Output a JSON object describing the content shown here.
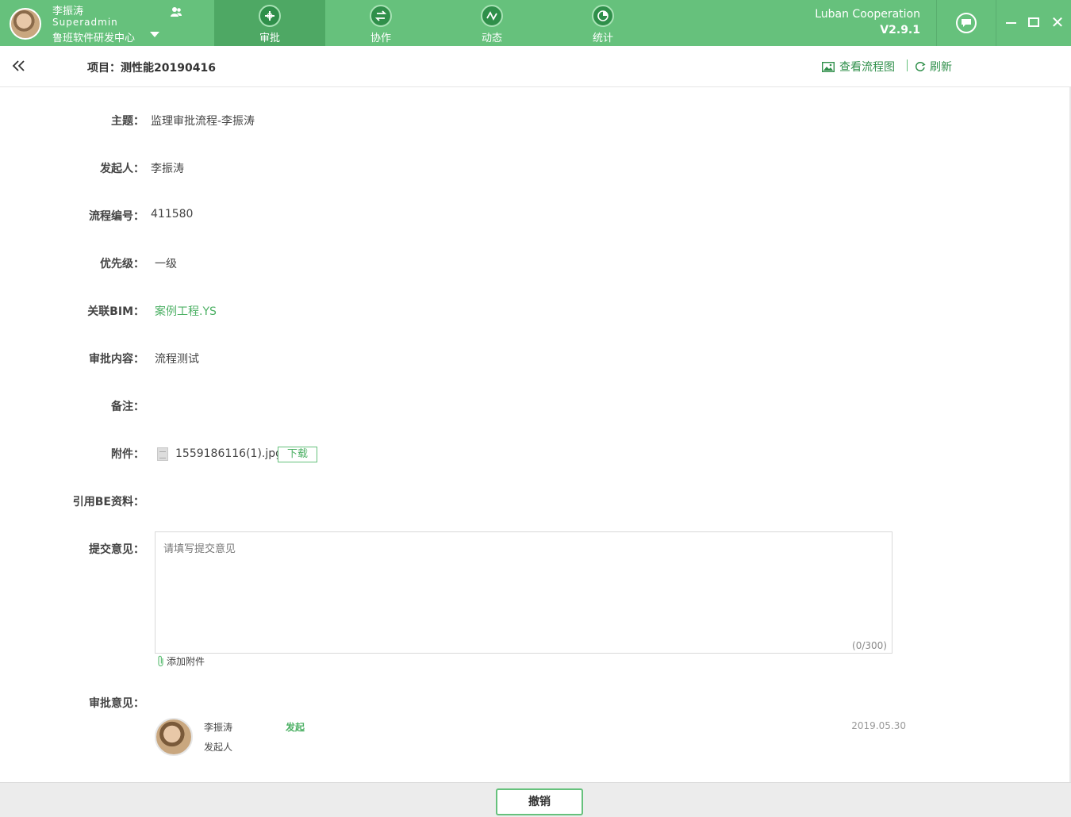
{
  "user": {
    "name": "李振涛",
    "role": "Superadmin",
    "org": "鲁班软件研发中心"
  },
  "nav": {
    "tabs": [
      {
        "label": "审批",
        "icon": "approval-icon",
        "active": true
      },
      {
        "label": "协作",
        "icon": "collaborate-icon",
        "active": false
      },
      {
        "label": "动态",
        "icon": "activity-icon",
        "active": false
      },
      {
        "label": "统计",
        "icon": "statistics-icon",
        "active": false
      }
    ]
  },
  "app": {
    "brand": "Luban Cooperation",
    "version": "V2.9.1",
    "accent": "#66c17c"
  },
  "header": {
    "project": "项目：测性能20190416",
    "view_flow": "查看流程图",
    "refresh": "刷新"
  },
  "form": {
    "subject_label": "主题：",
    "subject_value": "监理审批流程-李振涛",
    "initiator_label": "发起人：",
    "initiator_value": "李振涛",
    "flow_no_label": "流程编号：",
    "flow_no_value": "411580",
    "priority_label": "优先级：",
    "priority_value": "一级",
    "bim_label": "关联BIM：",
    "bim_value": "案例工程.YS",
    "content_label": "审批内容：",
    "content_value": "流程测试",
    "remark_label": "备注：",
    "attachment_label": "附件：",
    "attachment_file": "1559186116(1).jpg",
    "download_label": "下载",
    "be_label": "引用BE资料：",
    "submit_label": "提交意见：",
    "submit_placeholder": "请填写提交意见",
    "counter": "(0/300)",
    "add_attachment": "添加附件",
    "approval_label": "审批意见："
  },
  "approval": {
    "name": "李振涛",
    "role": "发起人",
    "action": "发起",
    "date": "2019.05.30"
  },
  "footer": {
    "revoke": "撤销"
  }
}
